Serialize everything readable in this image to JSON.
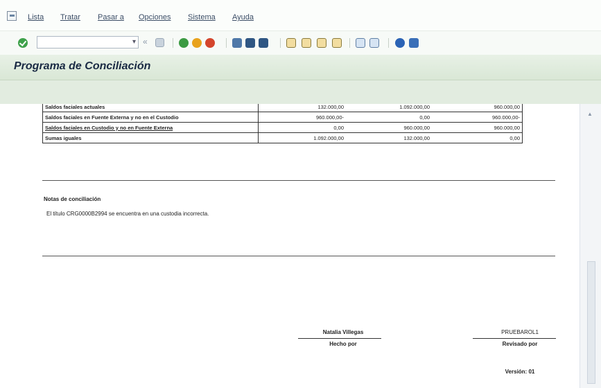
{
  "menu": {
    "items": [
      "Lista",
      "Tratar",
      "Pasar a",
      "Opciones",
      "Sistema",
      "Ayuda"
    ]
  },
  "toolbar": {
    "command_value": "",
    "nav_back_symbol": "«",
    "dropdown_symbol": "▾",
    "icons": [
      "ok-icon",
      "save-icon",
      "back-icon",
      "exit-icon",
      "cancel-icon",
      "print-icon",
      "find-icon",
      "find-next-icon",
      "first-page-icon",
      "previous-page-icon",
      "next-page-icon",
      "last-page-icon",
      "create-session-icon",
      "shortcut-icon",
      "help-icon",
      "customize-layout-icon"
    ]
  },
  "title": "Programa de Conciliación",
  "report": {
    "rows": [
      {
        "label": "Saldos faciales actuales",
        "c1": "132.000,00",
        "c2": "1.092.000,00",
        "c3": "960.000,00"
      },
      {
        "label": "Saldos faciales en Fuente Externa y no en el Custodio",
        "c1": "960.000,00-",
        "c2": "0,00",
        "c3": "960.000,00-"
      },
      {
        "label": "Saldos faciales en Custodio y no en Fuente Externa",
        "c1": "0,00",
        "c2": "960.000,00",
        "c3": "960.000,00"
      },
      {
        "label": "Sumas iguales",
        "c1": "1.092.000,00",
        "c2": "132.000,00",
        "c3": "0,00"
      }
    ],
    "notes_title": "Notas de conciliación",
    "notes_text": "El título CRG0000B2994 se encuentra en una custodia incorrecta.",
    "signatures": {
      "made_by_name": "Natalia Villegas",
      "made_by_label": "Hecho por",
      "reviewed_by_name": "PRUEBAROL1",
      "reviewed_by_label": "Revisado por",
      "version": "Versión: 01"
    }
  },
  "colors": {
    "title_bar": "#dde9da",
    "ok_green": "#3ea14a",
    "title_text": "#1a2a44"
  }
}
